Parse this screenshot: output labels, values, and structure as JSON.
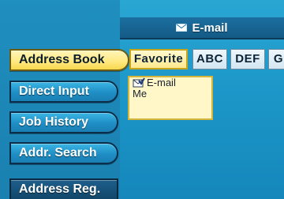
{
  "header": {
    "title": "E-mail",
    "icon": "envelope-icon"
  },
  "sidebar": {
    "items": [
      {
        "label": "Address Book",
        "active": true
      },
      {
        "label": "Direct Input",
        "active": false
      },
      {
        "label": "Job History",
        "active": false
      },
      {
        "label": "Addr. Search",
        "active": false
      },
      {
        "label": "Address Reg.",
        "active": false
      }
    ]
  },
  "tabs": [
    {
      "label": "Favorite",
      "active": true
    },
    {
      "label": "ABC",
      "active": false
    },
    {
      "label": "DEF",
      "active": false
    },
    {
      "label": "G",
      "active": false
    }
  ],
  "list": {
    "entries": [
      {
        "type_label": "E-mail",
        "name": "Me",
        "checked": true
      }
    ]
  },
  "colors": {
    "screen_bg": "#1c97c8",
    "active_highlight": "#ffe87f",
    "header_bg": "#145a86"
  }
}
